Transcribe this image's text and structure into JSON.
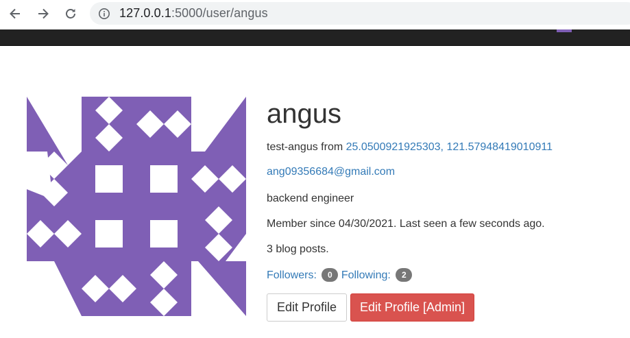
{
  "browser": {
    "url_host": "127.0.0.1",
    "url_rest": ":5000/user/angus"
  },
  "profile": {
    "username": "angus",
    "name": "test-angus",
    "from_label": "from",
    "location": "25.0500921925303, 121.57948419010911",
    "email": "ang09356684@gmail.com",
    "about": "backend engineer",
    "member_since": "Member since 04/30/2021. Last seen a few seconds ago.",
    "posts": "3 blog posts.",
    "followers_label": "Followers:",
    "followers_count": "0",
    "following_label": "Following:",
    "following_count": "2"
  },
  "actions": {
    "edit_profile": "Edit Profile",
    "edit_profile_admin": "Edit Profile [Admin]"
  },
  "icons": {
    "back": "arrow-left-icon",
    "forward": "arrow-right-icon",
    "reload": "reload-icon",
    "info": "info-icon"
  },
  "colors": {
    "identicon": "#7f5fb5",
    "link": "#337ab7",
    "danger": "#d9534f",
    "navbar": "#222222",
    "badge": "#777777"
  }
}
